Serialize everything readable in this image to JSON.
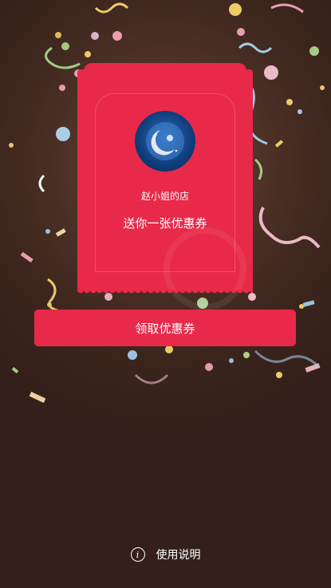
{
  "coupon": {
    "shop_name": "赵小姐的店",
    "message": "送你一张优惠券"
  },
  "claim_button": {
    "label": "领取优惠券"
  },
  "help": {
    "label": "使用说明",
    "icon": "info-icon"
  },
  "colors": {
    "accent": "#e8294a",
    "background": "#3a241c",
    "text": "#ffffff"
  }
}
